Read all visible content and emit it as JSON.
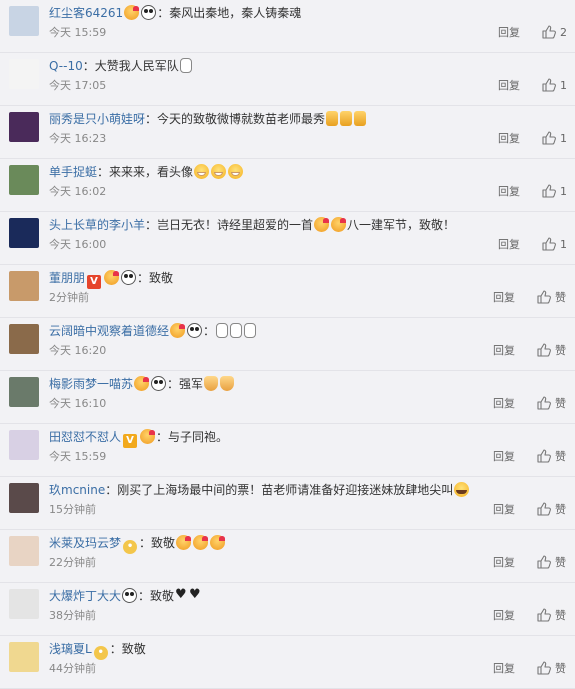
{
  "ui": {
    "reply_label": "回复",
    "like_label_zero": "赞"
  },
  "comments": [
    {
      "user": "红尘客64261",
      "sep": "：",
      "text": "秦风出秦地，秦人铸秦魂",
      "time": "今天 15:59",
      "likes": "2",
      "avatar_color": "#c8d4e4",
      "pre_emojis": [
        "kiss",
        "panda"
      ],
      "post_emojis": []
    },
    {
      "user": "Q--10",
      "sep": "：",
      "text": "大赞我人民军队",
      "time": "今天 17:05",
      "likes": "1",
      "avatar_color": "#f4f4f4",
      "pre_emojis": [],
      "post_emojis": [
        "hand"
      ]
    },
    {
      "user": "丽秀是只小萌娃呀",
      "sep": "：",
      "text": "今天的致敬微博就数苗老师最秀",
      "time": "今天 16:23",
      "likes": "1",
      "avatar_color": "#4a2a5a",
      "pre_emojis": [],
      "post_emojis": [
        "thumb",
        "thumb",
        "thumb"
      ]
    },
    {
      "user": "单手捉蜓",
      "sep": "：",
      "text": "来来来，看头像",
      "time": "今天 16:02",
      "likes": "1",
      "avatar_color": "#6a8a5a",
      "pre_emojis": [],
      "post_emojis": [
        "grin",
        "grin",
        "grin"
      ]
    },
    {
      "user": "头上长草的李小羊",
      "sep": "：",
      "text": "岂日无衣！诗经里超爱的一首",
      "text2": "八一建军节，致敬！",
      "time": "今天 16:00",
      "likes": "1",
      "avatar_color": "#1a2a5a",
      "pre_emojis": [],
      "post_emojis": [
        "kiss",
        "kiss"
      ]
    },
    {
      "user": "董朋朋",
      "sep": "：",
      "text": "致敬",
      "time": "2分钟前",
      "likes": "赞",
      "avatar_color": "#c89a6a",
      "badge": "V",
      "pre_emojis": [
        "kiss",
        "panda"
      ],
      "post_emojis": []
    },
    {
      "user": "云阔暗中观察着道德经",
      "sep": "：",
      "text": "",
      "time": "今天 16:20",
      "likes": "赞",
      "avatar_color": "#8a6a4a",
      "pre_emojis": [
        "kiss",
        "panda"
      ],
      "post_emojis": [
        "hand",
        "hand",
        "hand"
      ]
    },
    {
      "user": "梅影雨梦一喵苏",
      "sep": "：",
      "text": "强军",
      "time": "今天 16:10",
      "likes": "赞",
      "avatar_color": "#6a7a6a",
      "pre_emojis": [
        "kiss",
        "panda"
      ],
      "post_emojis": [
        "clap",
        "clap"
      ]
    },
    {
      "user": "田怼怼不怼人",
      "sep": "：",
      "text": "与子同袍。",
      "time": "今天 15:59",
      "likes": "赞",
      "avatar_color": "#d8d0e4",
      "badge_gold": "V",
      "pre_emojis": [
        "kiss"
      ],
      "post_emojis": []
    },
    {
      "user": "玖mcnine",
      "sep": "：",
      "text": "刚买了上海场最中间的票！苗老师请准备好迎接迷妹放肆地尖叫",
      "time": "15分钟前",
      "likes": "赞",
      "avatar_color": "#5a4a4a",
      "pre_emojis": [],
      "post_emojis": [
        "lol"
      ]
    },
    {
      "user": "米莱及玛云梦",
      "sep": "：",
      "text": "致敬",
      "time": "22分钟前",
      "likes": "赞",
      "avatar_color": "#e8d4c4",
      "badge_lock": "•",
      "pre_emojis": [],
      "post_emojis": [
        "kiss",
        "kiss",
        "kiss"
      ]
    },
    {
      "user": "大爆炸丁大大",
      "sep": "：",
      "text": "致敬",
      "time": "38分钟前",
      "likes": "赞",
      "avatar_color": "#e4e4e4",
      "pre_emojis": [
        "panda"
      ],
      "post_emojis": [
        "heart",
        "heart"
      ]
    },
    {
      "user": "浅璃夏L",
      "sep": "：",
      "text": "致敬",
      "time": "44分钟前",
      "likes": "赞",
      "avatar_color": "#f0d890",
      "badge_lock": "•",
      "pre_emojis": [],
      "post_emojis": []
    }
  ]
}
